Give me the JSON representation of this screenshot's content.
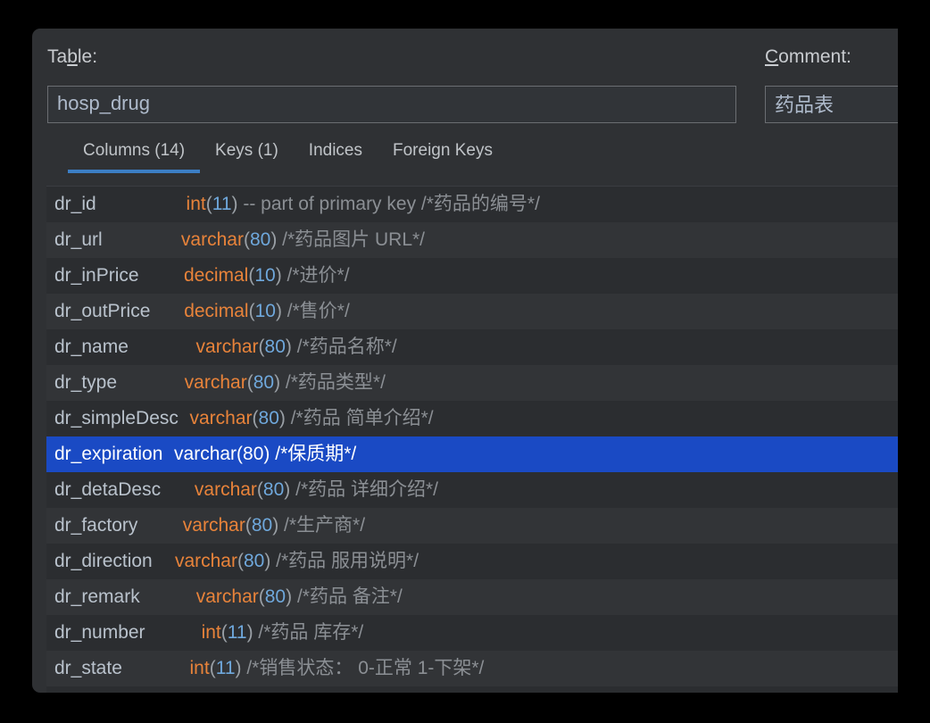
{
  "panel": {
    "background_color": "#2f3134",
    "list_background_color": "#2b2d30",
    "accent_color": "#3c7ec4",
    "selection_color": "#1a4ac4",
    "type_color": "#e8833a",
    "size_color": "#6fa8dc",
    "comment_color": "#8b8f94"
  },
  "header": {
    "table_label_pre": "Ta",
    "table_label_mnemonic": "b",
    "table_label_post": "le:",
    "table_label_full": "Table:",
    "table_name_value": "hosp_drug",
    "table_name_placeholder": "",
    "comment_label_mnemonic": "C",
    "comment_label_post": "omment:",
    "comment_label_full": "Comment:",
    "comment_value": "药品表",
    "comment_placeholder": ""
  },
  "tabs": [
    {
      "label": "Columns (14)",
      "active": true
    },
    {
      "label": "Keys (1)",
      "active": false
    },
    {
      "label": "Indices",
      "active": false
    },
    {
      "label": "Foreign Keys",
      "active": false
    }
  ],
  "columns": [
    {
      "name": "dr_id",
      "pad": "        ",
      "type": "int",
      "size": "11",
      "note": " -- part of primary key",
      "comment": " /*药品的编号*/",
      "selected": false
    },
    {
      "name": "dr_url",
      "pad": "       ",
      "type": "varchar",
      "size": "80",
      "note": "",
      "comment": " /*药品图片 URL*/",
      "selected": false
    },
    {
      "name": "dr_inPrice",
      "pad": "    ",
      "type": "decimal",
      "size": "10",
      "note": "",
      "comment": " /*进价*/",
      "selected": false
    },
    {
      "name": "dr_outPrice",
      "pad": "   ",
      "type": "decimal",
      "size": "10",
      "note": "",
      "comment": " /*售价*/",
      "selected": false
    },
    {
      "name": "dr_name",
      "pad": "      ",
      "type": "varchar",
      "size": "80",
      "note": "",
      "comment": " /*药品名称*/",
      "selected": false
    },
    {
      "name": "dr_type",
      "pad": "      ",
      "type": "varchar",
      "size": "80",
      "note": "",
      "comment": " /*药品类型*/",
      "selected": false
    },
    {
      "name": "dr_simpleDesc",
      "pad": " ",
      "type": "varchar",
      "size": "80",
      "note": "",
      "comment": " /*药品 简单介绍*/",
      "selected": false
    },
    {
      "name": "dr_expiration",
      "pad": " ",
      "type": "varchar",
      "size": "80",
      "note": "",
      "comment": " /*保质期*/",
      "selected": true
    },
    {
      "name": "dr_detaDesc",
      "pad": "   ",
      "type": "varchar",
      "size": "80",
      "note": "",
      "comment": " /*药品 详细介绍*/",
      "selected": false
    },
    {
      "name": "dr_factory",
      "pad": "    ",
      "type": "varchar",
      "size": "80",
      "note": "",
      "comment": " /*生产商*/",
      "selected": false
    },
    {
      "name": "dr_direction",
      "pad": "  ",
      "type": "varchar",
      "size": "80",
      "note": "",
      "comment": " /*药品 服用说明*/",
      "selected": false
    },
    {
      "name": "dr_remark",
      "pad": "     ",
      "type": "varchar",
      "size": "80",
      "note": "",
      "comment": " /*药品 备注*/",
      "selected": false
    },
    {
      "name": "dr_number",
      "pad": "     ",
      "type": "int",
      "size": "11",
      "note": "",
      "comment": " /*药品 库存*/",
      "selected": false
    },
    {
      "name": "dr_state",
      "pad": "      ",
      "type": "int",
      "size": "11",
      "note": "",
      "comment": " /*销售状态： 0-正常 1-下架*/",
      "selected": false
    }
  ]
}
